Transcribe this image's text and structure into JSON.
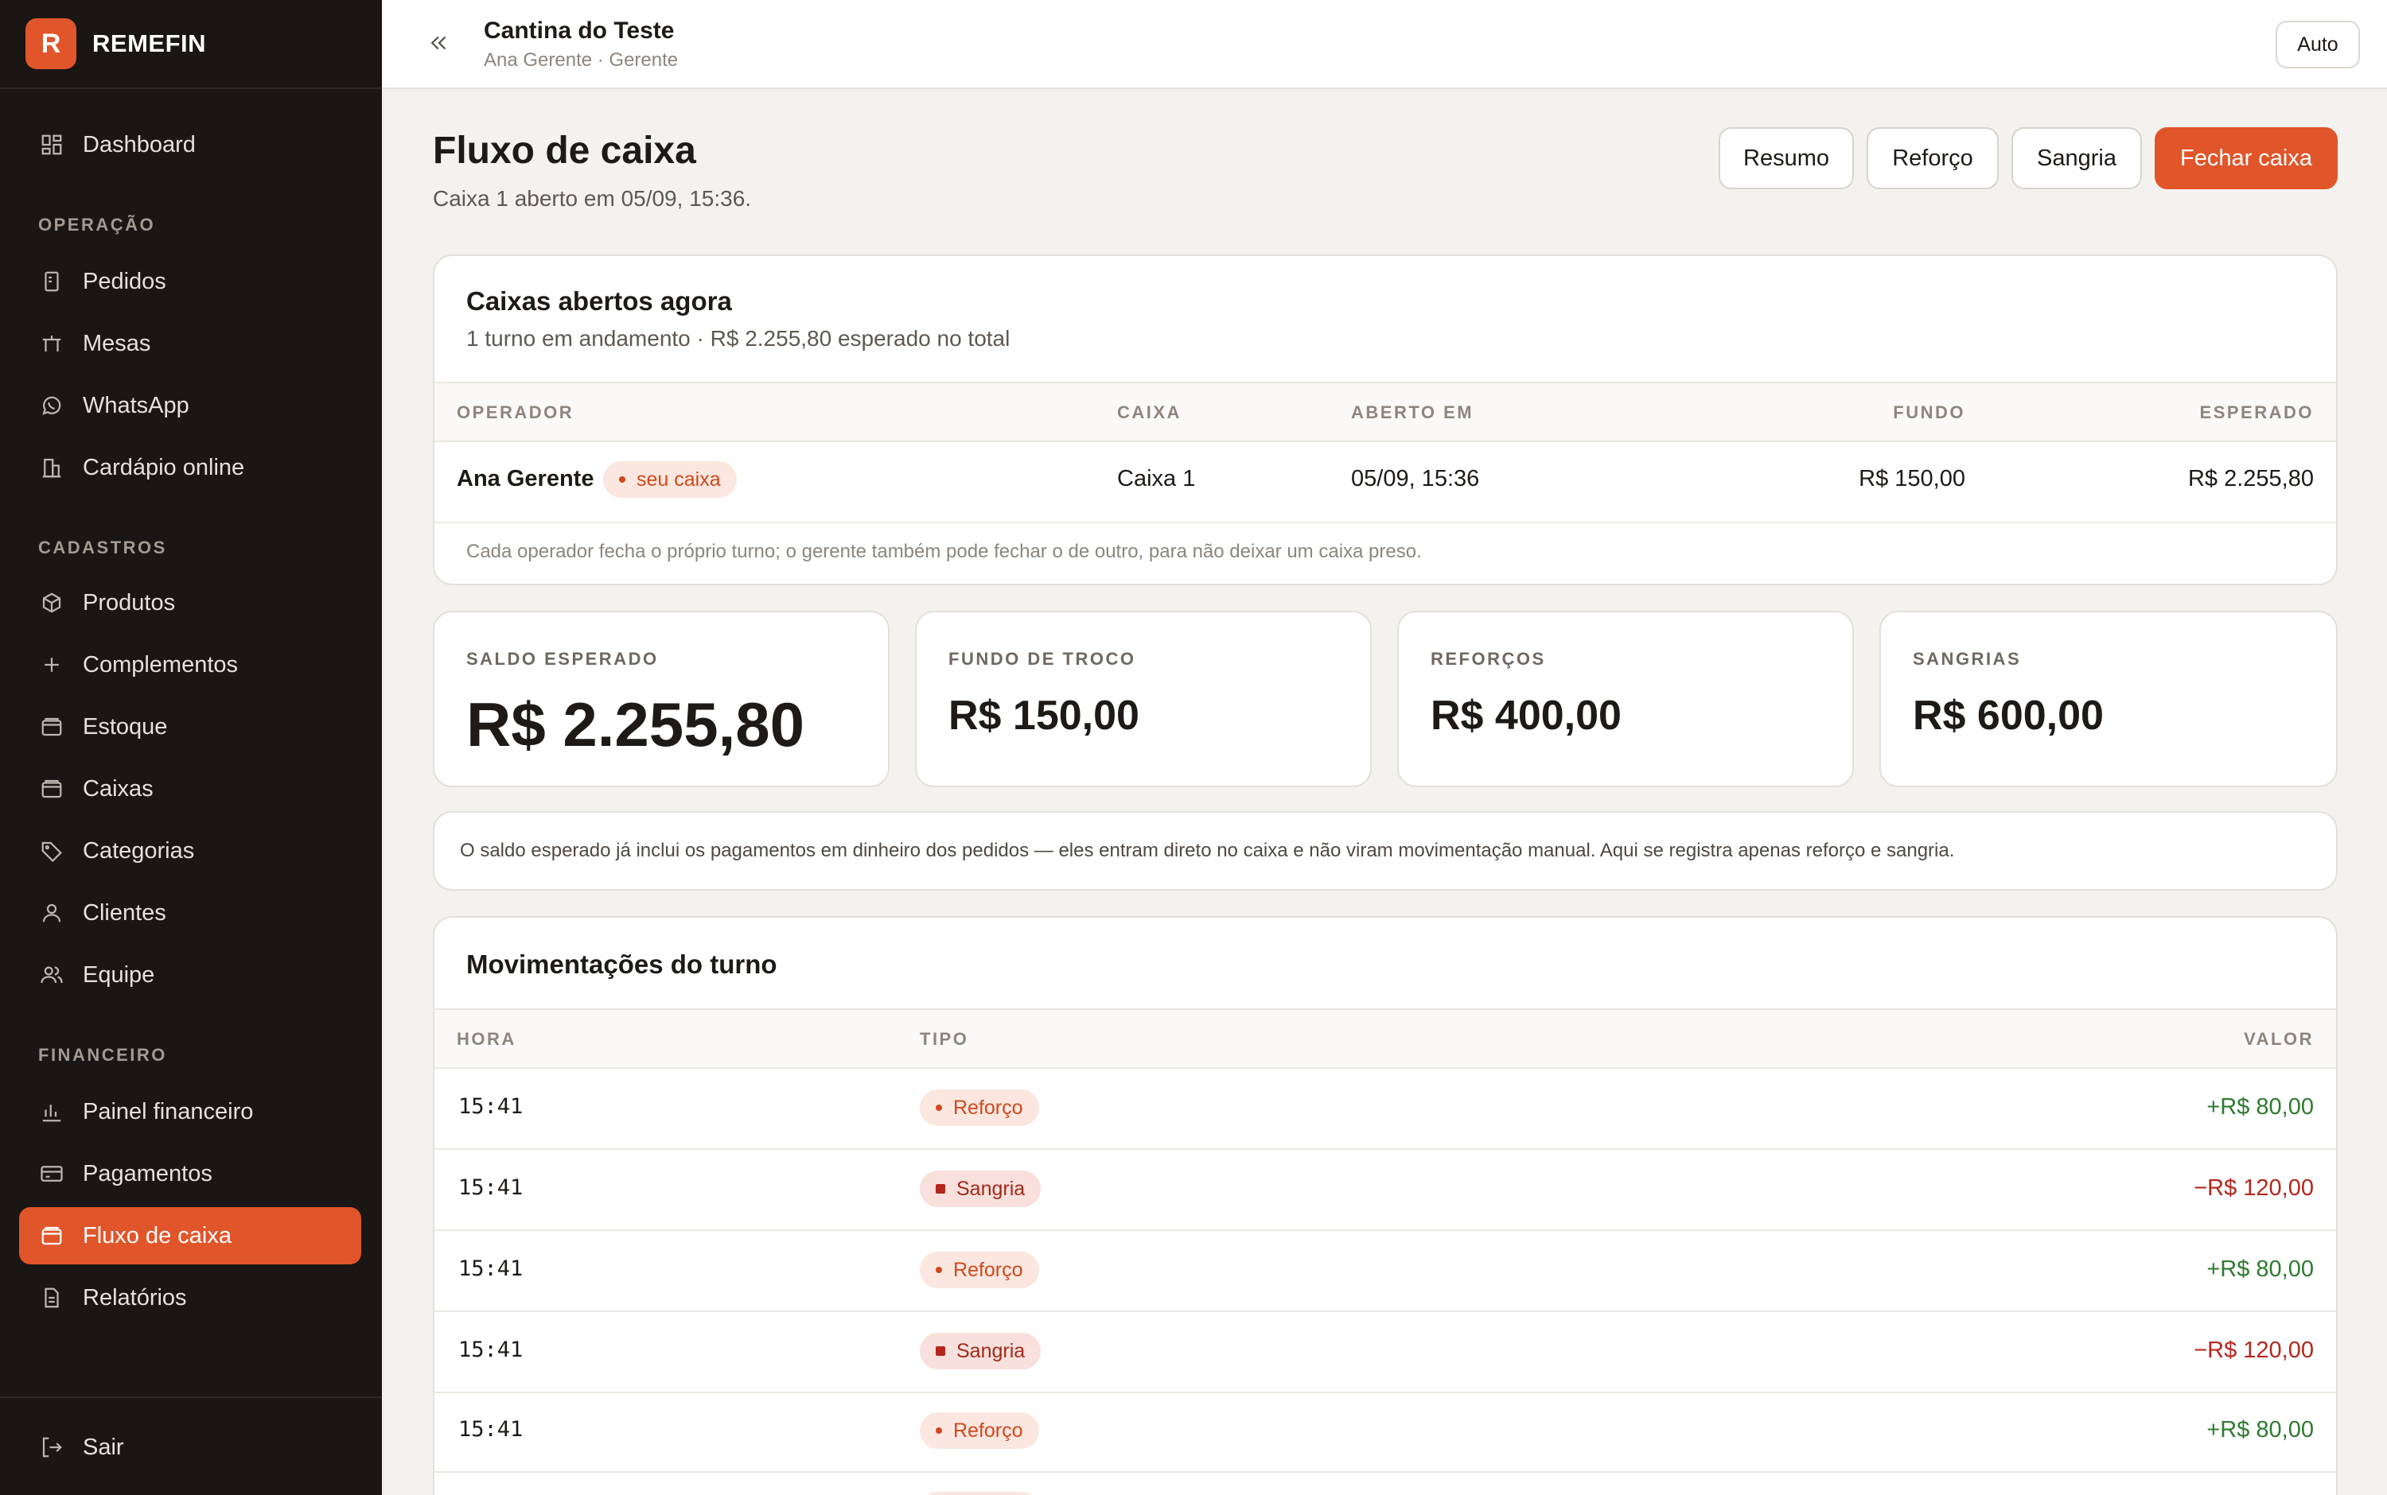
{
  "brand": {
    "logo_letter": "R",
    "name": "REMEFIN"
  },
  "sidebar": {
    "dashboard": "Dashboard",
    "sections": {
      "operacao": "OPERAÇÃO",
      "cadastros": "CADASTROS",
      "financeiro": "FINANCEIRO"
    },
    "items": {
      "pedidos": "Pedidos",
      "mesas": "Mesas",
      "whatsapp": "WhatsApp",
      "cardapio": "Cardápio online",
      "produtos": "Produtos",
      "complementos": "Complementos",
      "estoque": "Estoque",
      "caixas": "Caixas",
      "categorias": "Categorias",
      "clientes": "Clientes",
      "equipe": "Equipe",
      "painel": "Painel financeiro",
      "pagamentos": "Pagamentos",
      "fluxo": "Fluxo de caixa",
      "relatorios": "Relatórios"
    },
    "logout": "Sair",
    "active_color": "#e0552a"
  },
  "topbar": {
    "store_name": "Cantina do Teste",
    "user": "Ana Gerente · Gerente",
    "mode": "Auto"
  },
  "header": {
    "title": "Fluxo de caixa",
    "subtitle": "Caixa 1 aberto em 05/09, 15:36.",
    "buttons": {
      "resumo": "Resumo",
      "reforco": "Reforço",
      "sangria": "Sangria",
      "fechar": "Fechar caixa"
    }
  },
  "open_registers": {
    "title": "Caixas abertos agora",
    "subtitle": "1 turno em andamento · R$ 2.255,80 esperado no total",
    "columns": {
      "operador": "OPERADOR",
      "caixa": "CAIXA",
      "aberto": "ABERTO EM",
      "fundo": "FUNDO",
      "esperado": "ESPERADO"
    },
    "row": {
      "operador": "Ana Gerente",
      "badge": "seu caixa",
      "caixa": "Caixa 1",
      "aberto": "05/09, 15:36",
      "fundo": "R$ 150,00",
      "esperado": "R$ 2.255,80"
    },
    "note": "Cada operador fecha o próprio turno; o gerente também pode fechar o de outro, para não deixar um caixa preso."
  },
  "stats": {
    "saldo": {
      "label": "SALDO ESPERADO",
      "value": "R$ 2.255,80"
    },
    "fundo": {
      "label": "FUNDO DE TROCO",
      "value": "R$ 150,00"
    },
    "reforcos": {
      "label": "REFORÇOS",
      "value": "R$ 400,00"
    },
    "sangrias": {
      "label": "SANGRIAS",
      "value": "R$ 600,00"
    }
  },
  "info_note": "O saldo esperado já inclui os pagamentos em dinheiro dos pedidos — eles entram direto no caixa e não viram movimentação manual. Aqui se registra apenas reforço e sangria.",
  "movements": {
    "title": "Movimentações do turno",
    "columns": {
      "hora": "HORA",
      "tipo": "TIPO",
      "valor": "VALOR"
    },
    "rows": [
      {
        "hora": "15:41",
        "tipo": "Reforço",
        "valor": "+R$ 80,00"
      },
      {
        "hora": "15:41",
        "tipo": "Sangria",
        "valor": "−R$ 120,00"
      },
      {
        "hora": "15:41",
        "tipo": "Reforço",
        "valor": "+R$ 80,00"
      },
      {
        "hora": "15:41",
        "tipo": "Sangria",
        "valor": "−R$ 120,00"
      },
      {
        "hora": "15:41",
        "tipo": "Reforço",
        "valor": "+R$ 80,00"
      }
    ]
  }
}
